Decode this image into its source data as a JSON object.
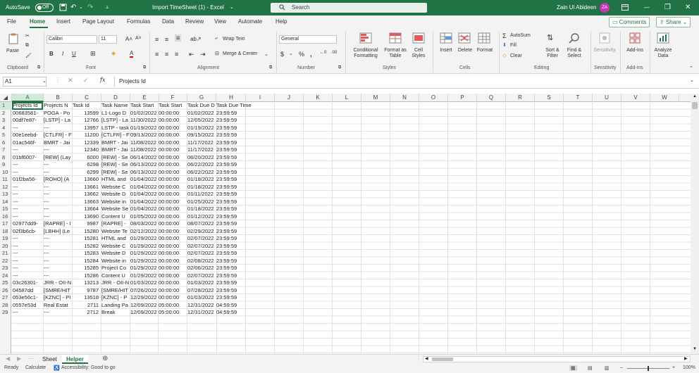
{
  "titlebar": {
    "autosave_label": "AutoSave",
    "autosave_state": "Off",
    "doc_title": "Import TimeSheet (1)  -  Excel",
    "search_placeholder": "Search",
    "user_name": "Zain Ul Abideen",
    "user_initials": "ZA"
  },
  "menu": {
    "items": [
      "File",
      "Home",
      "Insert",
      "Page Layout",
      "Formulas",
      "Data",
      "Review",
      "View",
      "Automate",
      "Help"
    ],
    "active": "Home",
    "comments_label": "Comments",
    "share_label": "Share"
  },
  "ribbon": {
    "clipboard": {
      "paste": "Paste",
      "group": "Clipboard"
    },
    "font": {
      "name": "Calibri",
      "size": "11",
      "group": "Font"
    },
    "alignment": {
      "wrap": "Wrap Text",
      "merge": "Merge & Center",
      "group": "Alignment"
    },
    "number": {
      "format": "General",
      "group": "Number"
    },
    "styles": {
      "conditional": "Conditional Formatting",
      "format_table": "Format as Table",
      "cell_styles": "Cell Styles",
      "group": "Styles"
    },
    "cells": {
      "insert": "Insert",
      "delete": "Delete",
      "format": "Format",
      "group": "Cells"
    },
    "editing": {
      "autosum": "AutoSum",
      "fill": "Fill",
      "clear": "Clear",
      "sort": "Sort & Filter",
      "find": "Find & Select",
      "group": "Editing"
    },
    "sensitivity": {
      "label": "Sensitivity",
      "group": "Sensitivity"
    },
    "addins": {
      "label": "Add-ins",
      "group": "Add-ins"
    },
    "analyze": {
      "label": "Analyze Data"
    }
  },
  "formula_bar": {
    "name_box": "A1",
    "fx": "fx",
    "value": "Projects Id"
  },
  "columns": [
    "A",
    "B",
    "C",
    "D",
    "E",
    "F",
    "G",
    "H",
    "I",
    "J",
    "K",
    "L",
    "M",
    "N",
    "O",
    "P",
    "Q",
    "R",
    "S",
    "T",
    "U",
    "V",
    "W"
  ],
  "rows": [
    [
      "Projects Id",
      "Projects N",
      "Task Id",
      "Task Name",
      "Task Start",
      "Task Start",
      "Task Due D",
      "Task Due Time"
    ],
    [
      "00683581-",
      "POGA - Po",
      "13599",
      "L1-Logo D",
      "01/02/2022",
      "00:00:00",
      "01/02/2022",
      "23:59:59"
    ],
    [
      "00df7e87-",
      "[LSTP] - La",
      "12766",
      "[LSTP] - La",
      "11/30/2022",
      "00:00:00",
      "12/05/2022",
      "23:59:59"
    ],
    [
      "---",
      "---",
      "13957",
      "LSTP - task",
      "01/19/2022",
      "00:00:00",
      "01/19/2022",
      "23:59:59"
    ],
    [
      "00e1eebd-",
      "[CTLFR] - F",
      "11200",
      "[CTLFR] - F",
      "09/13/2022",
      "00:00:00",
      "09/15/2022",
      "23:59:59"
    ],
    [
      "01ac546f-",
      "BMRT - Jai",
      "12339",
      "BMRT - Jai",
      "11/08/2022",
      "00:00:00",
      "11/17/2022",
      "23:59:59"
    ],
    [
      "---",
      "---",
      "12340",
      "BMRT - Jai",
      "11/08/2022",
      "00:00:00",
      "11/17/2022",
      "23:59:59"
    ],
    [
      "01bf6007-",
      "[REW] (Lay",
      "6000",
      "[REW] - Se",
      "06/14/2022",
      "00:00:00",
      "06/20/2022",
      "23:59:59"
    ],
    [
      "---",
      "---",
      "6298",
      "[REW] - Se",
      "06/13/2022",
      "00:00:00",
      "06/22/2022",
      "23:59:59"
    ],
    [
      "---",
      "---",
      "6299",
      "[REW] - Se",
      "06/13/2022",
      "00:00:00",
      "06/22/2022",
      "23:59:59"
    ],
    [
      "01f2ba56-",
      "[ROHO] (A",
      "13660",
      "HTML and",
      "01/04/2022",
      "00:00:00",
      "01/18/2022",
      "23:59:59"
    ],
    [
      "---",
      "---",
      "13661",
      "Website C",
      "01/04/2022",
      "00:00:00",
      "01/18/2022",
      "23:59:59"
    ],
    [
      "---",
      "---",
      "13662",
      "Website D",
      "01/04/2022",
      "00:00:00",
      "01/11/2022",
      "23:59:59"
    ],
    [
      "---",
      "---",
      "13663",
      "Website in",
      "01/04/2022",
      "00:00:00",
      "01/25/2022",
      "23:59:59"
    ],
    [
      "---",
      "---",
      "13664",
      "Website Se",
      "01/04/2022",
      "00:00:00",
      "01/18/2022",
      "23:59:59"
    ],
    [
      "---",
      "---",
      "13690",
      "Content U",
      "01/05/2022",
      "00:00:00",
      "01/12/2022",
      "23:59:59"
    ],
    [
      "02977dd9-",
      "[RAPRE] - I",
      "9987",
      "[RAPRE] - ",
      "08/03/2022",
      "00:00:00",
      "08/07/2022",
      "23:59:59"
    ],
    [
      "02f3b6cb-",
      "[LBHH] (Le",
      "15280",
      "Website Te",
      "02/12/2022",
      "00:00:00",
      "02/29/2022",
      "23:59:59"
    ],
    [
      "---",
      "---",
      "15281",
      "HTML and",
      "01/29/2022",
      "00:00:00",
      "02/07/2022",
      "23:59:59"
    ],
    [
      "---",
      "---",
      "15282",
      "Website C",
      "01/29/2022",
      "00:00:00",
      "02/07/2022",
      "23:59:59"
    ],
    [
      "---",
      "---",
      "15283",
      "Website D",
      "01/29/2022",
      "00:00:00",
      "02/07/2022",
      "23:59:59"
    ],
    [
      "---",
      "---",
      "15284",
      "Website in",
      "01/29/2022",
      "00:00:00",
      "02/08/2022",
      "23:59:59"
    ],
    [
      "---",
      "---",
      "15285",
      "Project Co",
      "01/29/2022",
      "00:00:00",
      "02/06/2022",
      "23:59:59"
    ],
    [
      "---",
      "---",
      "15286",
      "Content U",
      "01/29/2022",
      "00:00:00",
      "02/07/2022",
      "23:59:59"
    ],
    [
      "03c26301-",
      "JRR - OII-N",
      "13213",
      "JRR - OII-N",
      "01/03/2022",
      "00:00:00",
      "01/03/2022",
      "23:59:59"
    ],
    [
      "04587dd",
      "[SMRE/HIT",
      "9787",
      "[SMRE/HIT",
      "07/26/2022",
      "00:00:00",
      "07/28/2022",
      "23:59:59"
    ],
    [
      "053e56c1-",
      "[KZNC] - PI",
      "13518",
      "[KZNC] - P",
      "12/29/2022",
      "00:00:00",
      "01/03/2022",
      "23:59:59"
    ],
    [
      "0557e53d",
      "Real Estat",
      "2711",
      "Landing Pa",
      "12/09/2022",
      "05:00:00",
      "12/31/2022",
      "04:59:59"
    ],
    [
      "---",
      "---",
      "2712",
      "Break",
      "12/09/2022",
      "05:00:00",
      "12/31/2022",
      "04:59:59"
    ]
  ],
  "sheet_tabs": [
    "Sheet",
    "Helper"
  ],
  "active_tab": "Helper",
  "status": {
    "ready": "Ready",
    "calculate": "Calculate",
    "accessibility": "Accessibility: Good to go",
    "zoom": "100%"
  }
}
